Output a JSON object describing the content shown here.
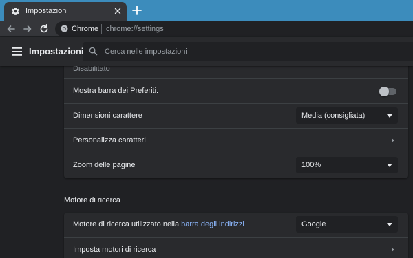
{
  "browser": {
    "tab_title": "Impostazioni",
    "site_name": "Chrome",
    "url": "chrome://settings",
    "accent_color": "#3c8cbc"
  },
  "icons": {
    "tab": "gear-icon",
    "tab_close": "close-icon",
    "new_tab": "plus-icon",
    "back": "arrow-left-icon",
    "forward": "arrow-right-icon",
    "reload": "reload-icon",
    "site": "chrome-icon",
    "menu": "hamburger-icon",
    "search": "search-icon",
    "expand": "chevron-right-icon",
    "dropdown": "triangle-down-icon"
  },
  "header": {
    "title": "Impostazioni",
    "search_placeholder": "Cerca nelle impostazioni"
  },
  "appearance": {
    "partial_sublabel": "Disabilitato",
    "bookmarks_bar": {
      "label": "Mostra barra dei Preferiti.",
      "enabled": false
    },
    "font_size": {
      "label": "Dimensioni carattere",
      "value": "Media (consigliata)"
    },
    "customize_fonts": {
      "label": "Personalizza caratteri"
    },
    "page_zoom": {
      "label": "Zoom delle pagine",
      "value": "100%"
    }
  },
  "search_engine": {
    "section_title": "Motore di ricerca",
    "engine_label_prefix": "Motore di ricerca utilizzato nella ",
    "engine_label_link": "barra degli indirizzi",
    "engine_value": "Google",
    "manage_label": "Imposta motori di ricerca"
  }
}
